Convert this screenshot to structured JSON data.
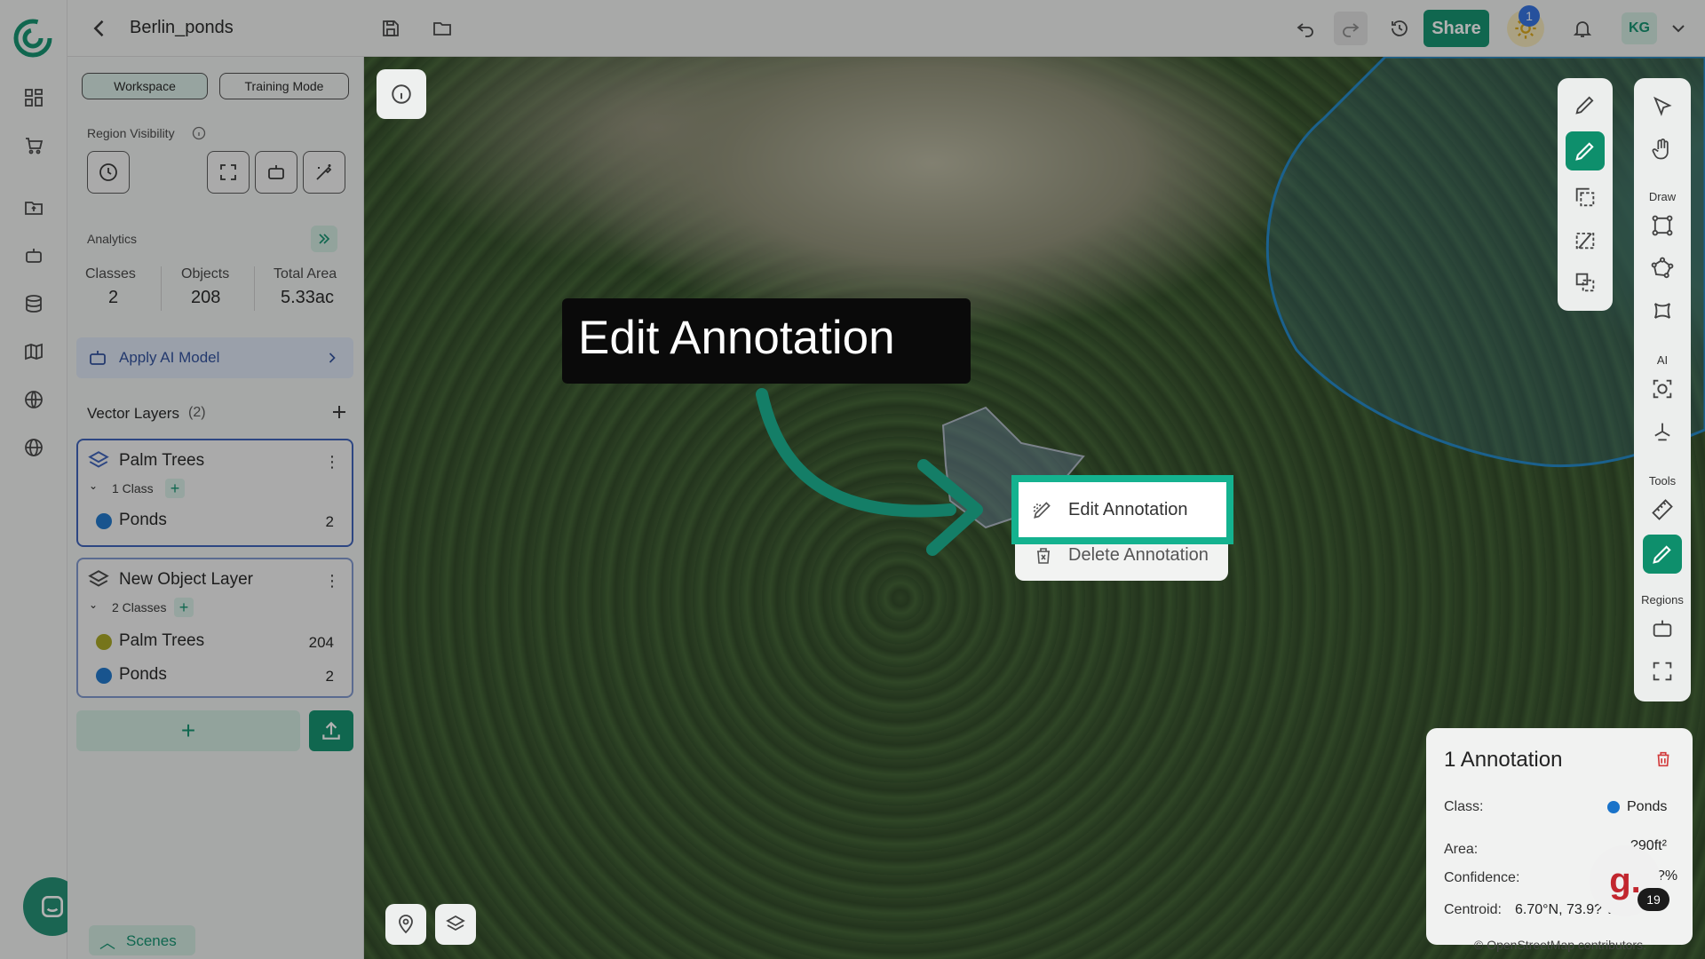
{
  "topbar": {
    "title": "Berlin_ponds",
    "share_label": "Share",
    "notifications_count": "1",
    "avatar_initials": "KG"
  },
  "panel": {
    "workspace_label": "Workspace",
    "training_label": "Training Mode",
    "region_visibility_label": "Region Visibility",
    "analytics": {
      "label": "Analytics",
      "classes_label": "Classes",
      "classes_value": "2",
      "objects_label": "Objects",
      "objects_value": "208",
      "area_label": "Total Area",
      "area_value": "5.33ac"
    },
    "ai_model_label": "Apply AI Model",
    "vector_layers_label": "Vector Layers",
    "vector_layers_count": "(2)",
    "layers": [
      {
        "name": "Palm Trees",
        "class_count": "1 Class",
        "rows": [
          {
            "label": "Ponds",
            "count": "2",
            "color": "#1a73c9"
          }
        ]
      },
      {
        "name": "New Object Layer",
        "class_count": "2 Classes",
        "rows": [
          {
            "label": "Palm Trees",
            "count": "204",
            "color": "#a6a51e"
          },
          {
            "label": "Ponds",
            "count": "2",
            "color": "#1a73c9"
          }
        ]
      }
    ],
    "scenes_label": "Scenes"
  },
  "callout": {
    "text": "Edit Annotation"
  },
  "context_menu": {
    "edit_label": "Edit Annotation",
    "delete_label": "Delete Annotation"
  },
  "toolbar": {
    "draw_label": "Draw",
    "ai_label": "AI",
    "tools_label": "Tools",
    "regions_label": "Regions"
  },
  "annotation_panel": {
    "title": "1 Annotation",
    "class_label": "Class:",
    "class_value": "Ponds",
    "area_label": "Area:",
    "area_value": "?90ft²",
    "confidence_label": "Confidence:",
    "confidence_value": "?%",
    "centroid_label": "Centroid:",
    "centroid_value": "6.70°N, 73.9? W"
  },
  "support_widget": {
    "letter": "g.",
    "count": "19"
  },
  "attribution": "© OpenStreetMap contributors."
}
